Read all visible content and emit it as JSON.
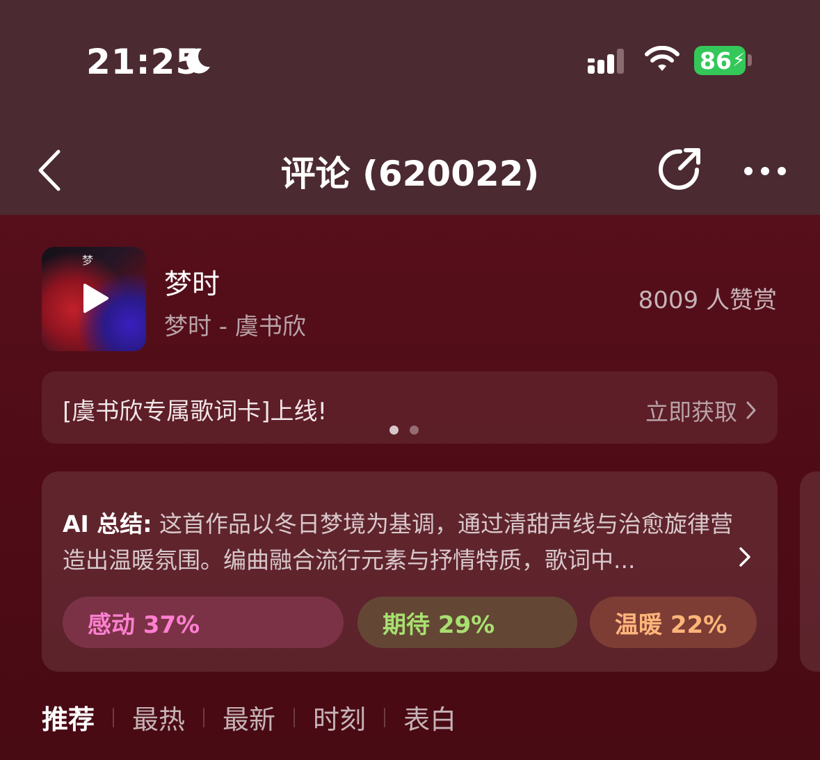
{
  "status_bar": {
    "time": "21:25",
    "battery": "86"
  },
  "nav": {
    "title": "评论 (620022)"
  },
  "song": {
    "title": "梦时",
    "subtitle": "梦时 - 虞书欣",
    "likes": "8009 人赞赏",
    "cover_text": "梦"
  },
  "banner": {
    "text": "[虞书欣专属歌词卡]上线!",
    "action": "立即获取",
    "pages": 2,
    "active_page": 0
  },
  "ai_summary": {
    "label": "AI 总结:",
    "text": "这首作品以冬日梦境为基调，通过清甜声线与治愈旋律营造出温暖氛围。编曲融合流行元素与抒情特质，歌词中..."
  },
  "tags": [
    {
      "label": "感动 37%",
      "color": "#ff7fd0"
    },
    {
      "label": "期待 29%",
      "color": "#a8e070"
    },
    {
      "label": "温暖 22%",
      "color": "#ffb57a"
    }
  ],
  "tabs": [
    {
      "label": "推荐",
      "active": true
    },
    {
      "label": "最热"
    },
    {
      "label": "最新"
    },
    {
      "label": "时刻"
    },
    {
      "label": "表白"
    }
  ],
  "icons": {
    "moon": "moon-icon",
    "signal": "signal-icon",
    "wifi": "wifi-icon",
    "back": "chevron-left-icon",
    "share": "share-icon",
    "more": "more-icon",
    "play": "play-icon"
  }
}
